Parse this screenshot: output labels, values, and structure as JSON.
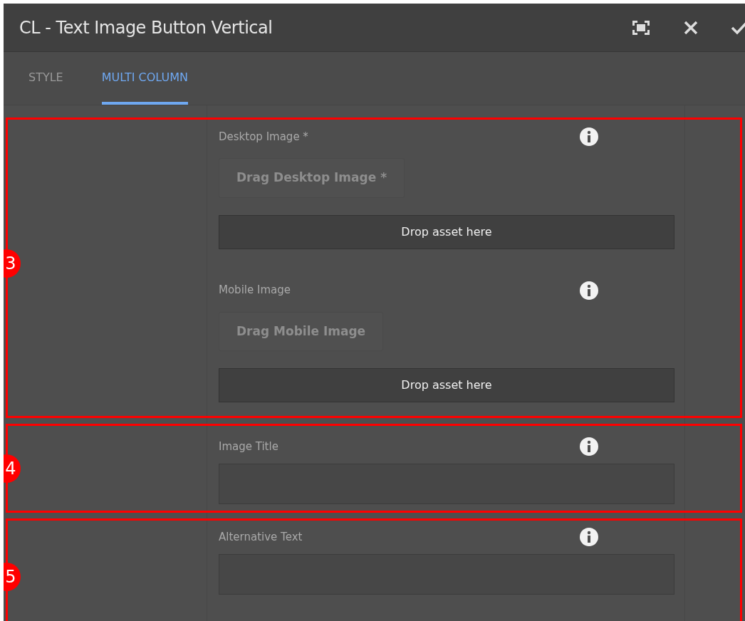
{
  "dialog": {
    "title": "CL - Text Image Button Vertical"
  },
  "tabs": [
    {
      "label": "STYLE",
      "selected": false
    },
    {
      "label": "MULTI COLUMN",
      "selected": true
    }
  ],
  "sections": [
    {
      "marker": "3",
      "fields": [
        {
          "kind": "image",
          "label": "Desktop Image *",
          "button": "Drag Desktop Image *",
          "drop_zone": "Drop asset here"
        },
        {
          "kind": "image",
          "label": "Mobile Image",
          "button": "Drag Mobile Image",
          "drop_zone": "Drop asset here"
        }
      ]
    },
    {
      "marker": "4",
      "fields": [
        {
          "kind": "text",
          "label": "Image Title"
        }
      ]
    },
    {
      "marker": "5",
      "fields": [
        {
          "kind": "text",
          "label": "Alternative Text"
        }
      ]
    }
  ]
}
